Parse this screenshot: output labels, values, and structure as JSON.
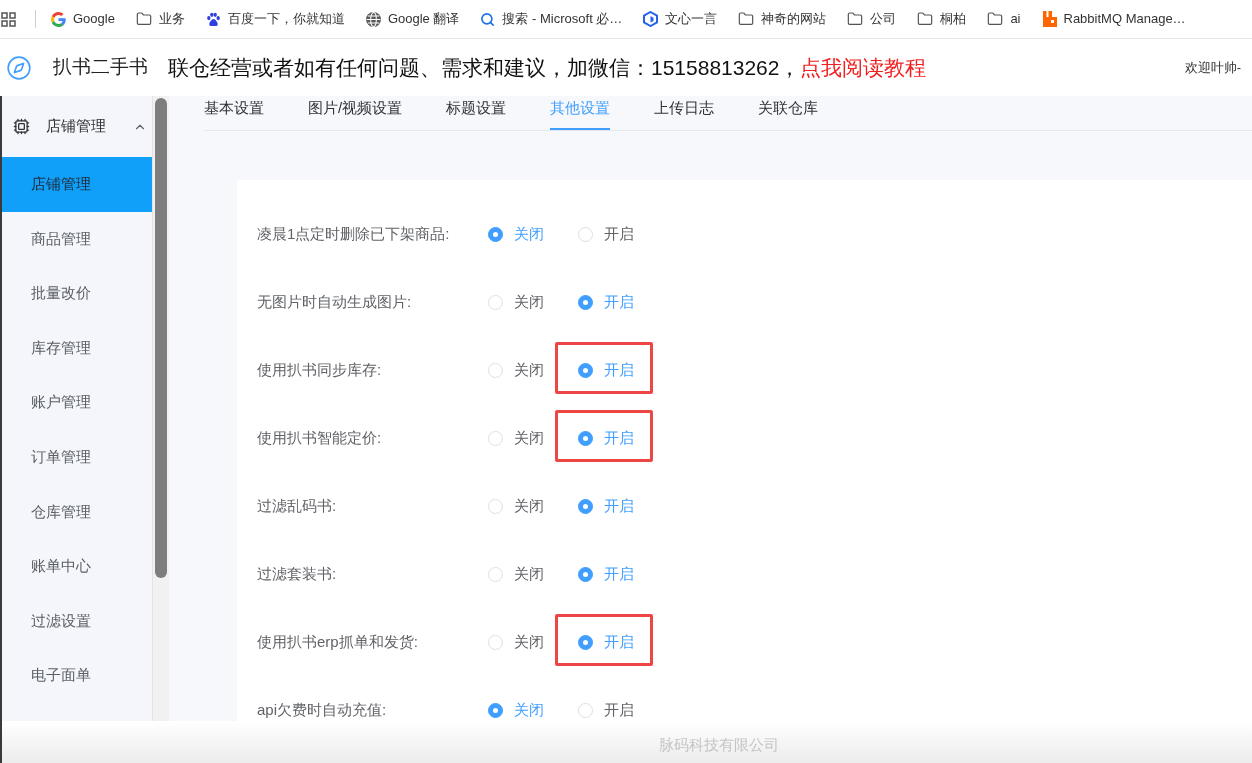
{
  "bookmarks_bar": {
    "items": [
      {
        "kind": "g-logo",
        "label": "Google"
      },
      {
        "kind": "folder",
        "label": "业务"
      },
      {
        "kind": "paw",
        "label": "百度一下，你就知道"
      },
      {
        "kind": "globe",
        "label": "Google 翻译"
      },
      {
        "kind": "search",
        "label": "搜索 - Microsoft 必…"
      },
      {
        "kind": "hexagon",
        "label": "文心一言"
      },
      {
        "kind": "folder",
        "label": "神奇的网站"
      },
      {
        "kind": "folder",
        "label": "公司"
      },
      {
        "kind": "folder",
        "label": "桐柏"
      },
      {
        "kind": "folder",
        "label": "ai"
      },
      {
        "kind": "block",
        "label": "RabbitMQ Manage…"
      }
    ]
  },
  "header": {
    "title": "扒书二手书",
    "notice": "联仓经营或者如有任何问题、需求和建议，加微信：15158813262，",
    "notice_link": "点我阅读教程",
    "welcome": "欢迎叶帅-"
  },
  "sidebar": {
    "group": {
      "label": "店铺管理",
      "expanded": true
    },
    "items": [
      {
        "label": "店铺管理",
        "selected": true
      },
      {
        "label": "商品管理",
        "selected": false
      },
      {
        "label": "批量改价",
        "selected": false
      },
      {
        "label": "库存管理",
        "selected": false
      },
      {
        "label": "账户管理",
        "selected": false
      },
      {
        "label": "订单管理",
        "selected": false
      },
      {
        "label": "仓库管理",
        "selected": false
      },
      {
        "label": "账单中心",
        "selected": false
      },
      {
        "label": "过滤设置",
        "selected": false
      },
      {
        "label": "电子面单",
        "selected": false
      }
    ]
  },
  "tabs": [
    {
      "label": "基本设置",
      "selected": false
    },
    {
      "label": "图片/视频设置",
      "selected": false
    },
    {
      "label": "标题设置",
      "selected": false
    },
    {
      "label": "其他设置",
      "selected": true
    },
    {
      "label": "上传日志",
      "selected": false
    },
    {
      "label": "关联仓库",
      "selected": false
    }
  ],
  "settings": [
    {
      "label": "凌晨1点定时删除已下架商品:",
      "options": [
        {
          "label": "关闭",
          "selected": true,
          "highlighted": false
        },
        {
          "label": "开启",
          "selected": false,
          "highlighted": false
        }
      ]
    },
    {
      "label": "无图片时自动生成图片:",
      "options": [
        {
          "label": "关闭",
          "selected": false,
          "highlighted": false
        },
        {
          "label": "开启",
          "selected": true,
          "highlighted": false
        }
      ]
    },
    {
      "label": "使用扒书同步库存:",
      "options": [
        {
          "label": "关闭",
          "selected": false,
          "highlighted": false
        },
        {
          "label": "开启",
          "selected": true,
          "highlighted": true
        }
      ]
    },
    {
      "label": "使用扒书智能定价:",
      "options": [
        {
          "label": "关闭",
          "selected": false,
          "highlighted": false
        },
        {
          "label": "开启",
          "selected": true,
          "highlighted": true
        }
      ]
    },
    {
      "label": "过滤乱码书:",
      "options": [
        {
          "label": "关闭",
          "selected": false,
          "highlighted": false
        },
        {
          "label": "开启",
          "selected": true,
          "highlighted": false
        }
      ]
    },
    {
      "label": "过滤套装书:",
      "options": [
        {
          "label": "关闭",
          "selected": false,
          "highlighted": false
        },
        {
          "label": "开启",
          "selected": true,
          "highlighted": false
        }
      ]
    },
    {
      "label": "使用扒书erp抓单和发货:",
      "options": [
        {
          "label": "关闭",
          "selected": false,
          "highlighted": false
        },
        {
          "label": "开启",
          "selected": true,
          "highlighted": true
        }
      ]
    },
    {
      "label": "api欠费时自动充值:",
      "options": [
        {
          "label": "关闭",
          "selected": true,
          "highlighted": false
        },
        {
          "label": "开启",
          "selected": false,
          "highlighted": false
        }
      ]
    }
  ],
  "footer": {
    "company": "脉码科技有限公司"
  }
}
